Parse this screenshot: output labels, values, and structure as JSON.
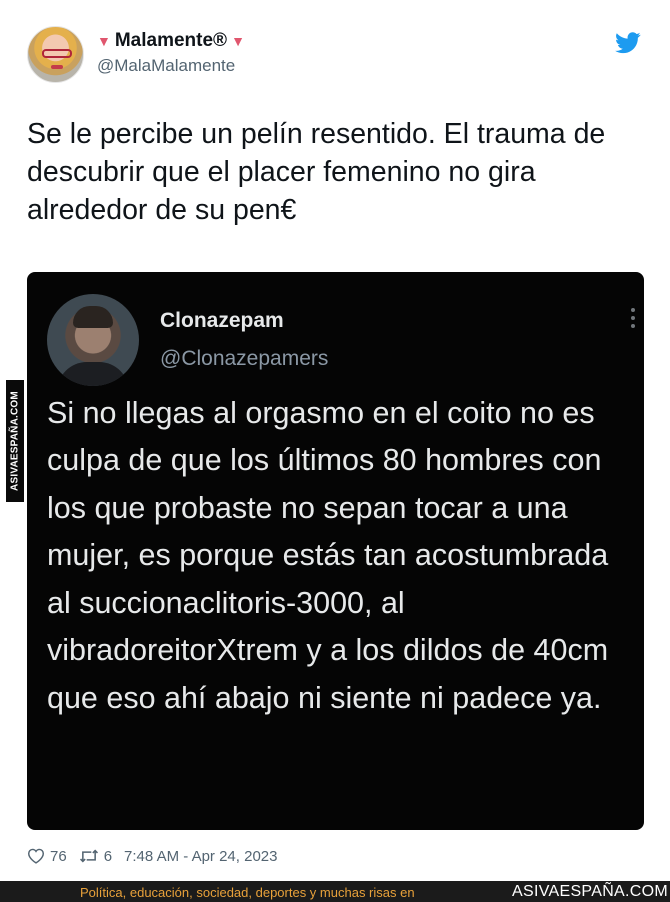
{
  "tweet": {
    "author": {
      "display_name": "Malamente®",
      "name_prefix": "▼",
      "name_suffix": "▼",
      "handle": "@MalaMalamente"
    },
    "text": "Se le percibe un pelín resentido. El trauma de descubrir que el placer femenino no gira alrededor de su pen€",
    "quoted": {
      "display_name": "Clonazepam",
      "handle": "@Clonazepamers",
      "text": "Si no llegas al orgasmo en el coito no es culpa de que los últimos 80 hombres con los que probaste no sepan tocar a una mujer, es porque estás tan acostumbrada al succionaclitoris-3000, al vibradoreitorXtrem y a los dildos de 40cm que eso ahí abajo ni siente ni padece ya."
    },
    "stats": {
      "likes": "76",
      "retweets": "6",
      "timestamp": "7:48 AM - Apr 24, 2023"
    }
  },
  "watermark": "ASIVAESPAÑA.COM",
  "footer": {
    "slogan": "Política, educación, sociedad, deportes y muchas risas en",
    "brand": "ASIVAESPAÑA.COM"
  },
  "colors": {
    "twitter_blue": "#1d9bf0",
    "name_triangles": "#e0566e",
    "card_bg": "#050505",
    "footer_bg": "#1b1b1b",
    "footer_slogan": "#e8a13a"
  },
  "icons": [
    "twitter-bird-icon",
    "more-dots-icon",
    "heart-icon",
    "retweet-icon"
  ]
}
